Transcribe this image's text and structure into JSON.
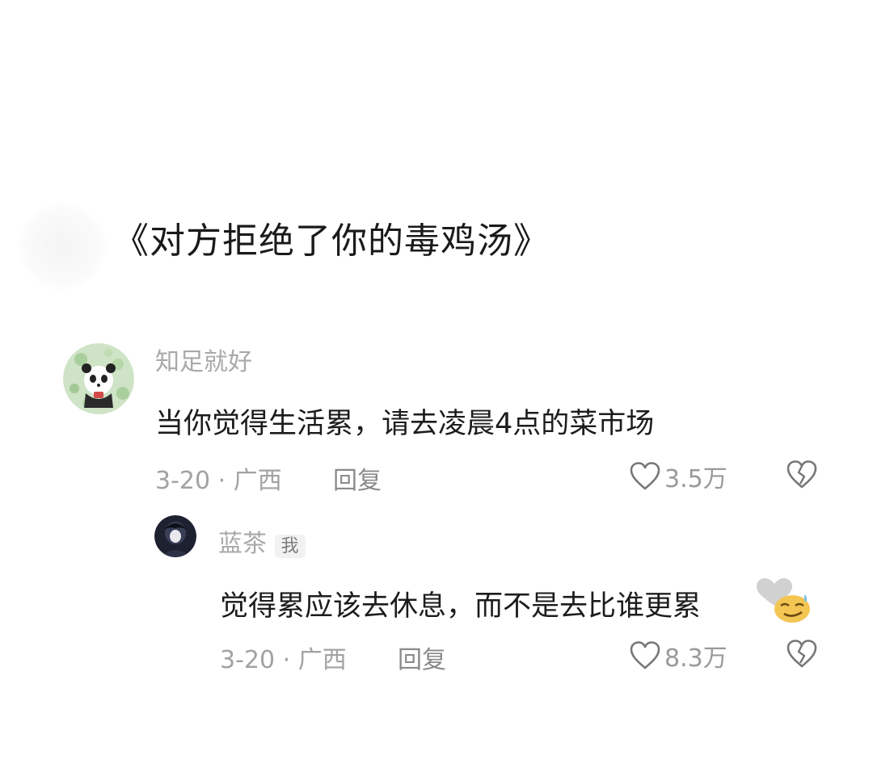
{
  "post": {
    "title": "《对方拒绝了你的毒鸡汤》"
  },
  "comments": [
    {
      "username": "知足就好",
      "text": "当你觉得生活累，请去凌晨4点的菜市场",
      "date": "3-20",
      "sep": "·",
      "location": "广西",
      "reply_label": "回复",
      "likes": "3.5万"
    },
    {
      "username": "蓝茶",
      "badge": "我",
      "text": "觉得累应该去休息，而不是去比谁更累",
      "date": "3-20",
      "sep": "·",
      "location": "广西",
      "reply_label": "回复",
      "likes": "8.3万"
    }
  ],
  "icons": {
    "like": "heart-outline-icon",
    "dislike": "broken-heart-icon",
    "emoji": "smirk-emoji-icon"
  },
  "colors": {
    "text": "#1c1c1c",
    "muted": "#a2a2a2",
    "background": "#ffffff"
  }
}
